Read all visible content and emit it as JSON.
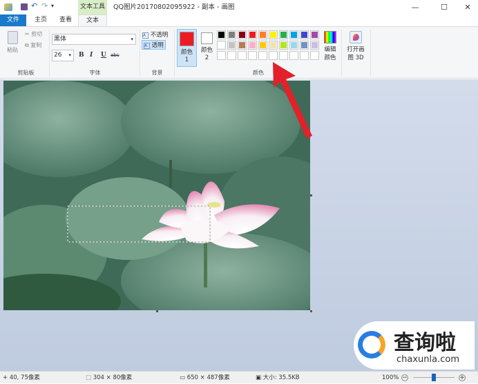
{
  "window": {
    "title": "QQ图片20170802095922 - 副本 - 画图",
    "context_tab": "文本工具",
    "minimize": "—",
    "maximize": "☐",
    "close": "✕"
  },
  "tabs": [
    {
      "label": "文件"
    },
    {
      "label": "主页"
    },
    {
      "label": "查看"
    },
    {
      "label": "文本"
    }
  ],
  "ribbon": {
    "clipboard": {
      "paste": "粘贴",
      "cut": "剪切",
      "copy": "复制",
      "label": "剪贴板"
    },
    "font": {
      "family": "黑体",
      "size": "26",
      "bold": "B",
      "italic": "I",
      "underline": "U",
      "strike": "abc",
      "label": "字体"
    },
    "background": {
      "opaque": "不透明",
      "transparent": "透明",
      "label": "背景"
    },
    "colors": {
      "color1": "颜色 1",
      "color2": "颜色 2",
      "edit": "编辑颜色",
      "label": "颜色",
      "color1_value": "#ed1c24",
      "color2_value": "#ffffff",
      "palette": [
        "#000000",
        "#7f7f7f",
        "#880015",
        "#ed1c24",
        "#ff7f27",
        "#fff200",
        "#22b14c",
        "#00a2e8",
        "#3f48cc",
        "#a349a4",
        "#ffffff",
        "#c3c3c3",
        "#b97a57",
        "#ffaec9",
        "#ffc90e",
        "#efe4b0",
        "#b5e61d",
        "#99d9ea",
        "#7092be",
        "#c8bfe7"
      ]
    },
    "paint3d": "打开画图 3D"
  },
  "status": {
    "cursor": "40, 75像素",
    "selection": "304 × 80像素",
    "image_size": "650 × 487像素",
    "file_size": "大小: 35.5KB",
    "zoom": "100%",
    "zoom_fraction": 0.5
  },
  "watermark": {
    "name": "查询啦",
    "url": "chaxunla.com"
  }
}
